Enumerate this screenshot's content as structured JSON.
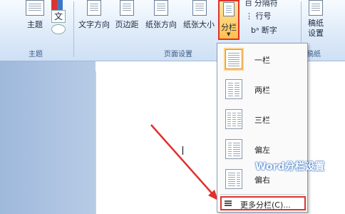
{
  "ribbon": {
    "groups": {
      "theme": "主题",
      "page_setup": "页面设置",
      "paper": "稿纸"
    },
    "buttons": {
      "theme": "主题",
      "text_direction": "文字方向",
      "margins": "页边距",
      "orientation": "纸张方向",
      "size": "纸张大小",
      "columns": "分栏",
      "paper_setup": "稿纸\n设置"
    },
    "small_items": {
      "breaks": "分隔符",
      "line_numbers": "行号",
      "hyphenation": "断字"
    },
    "theme_glyph": "文"
  },
  "menu": {
    "items": [
      {
        "label": "一栏",
        "cols": 1
      },
      {
        "label": "两栏",
        "cols": 2
      },
      {
        "label": "三栏",
        "cols": 3
      },
      {
        "label": "偏左",
        "cols": 2
      },
      {
        "label": "偏右",
        "cols": 2
      }
    ],
    "more": "更多分栏(C)..."
  },
  "watermark": "Word分栏设置",
  "colors": {
    "highlight": "#e0302a",
    "accent": "#ffc04a"
  }
}
